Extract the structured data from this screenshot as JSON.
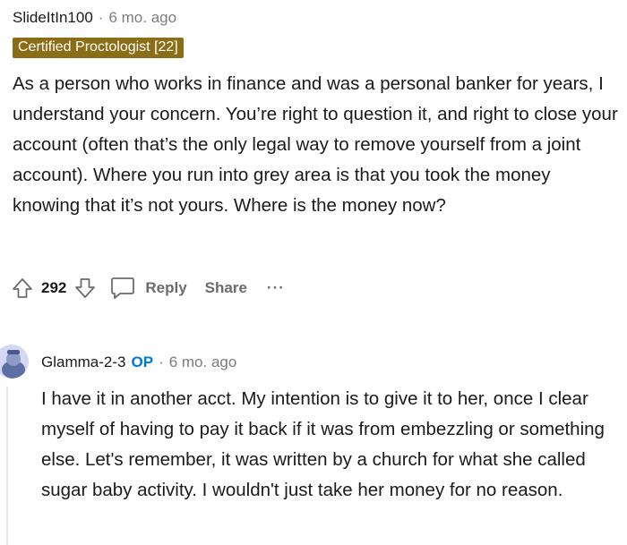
{
  "comment": {
    "username": "SlideItIn100",
    "separator": "·",
    "time": "6 mo. ago",
    "flair": "Certified Proctologist [22]",
    "body": "As a person who works in finance and was a personal banker for years, I understand your concern. You’re right to question it, and right to close your account (often that’s the only legal way to remove yourself from a joint account). Where you run into grey area is that you took the money knowing that it’s not yours. Where is the money now?",
    "score": "292",
    "reply_label": "Reply",
    "share_label": "Share",
    "more_label": "···"
  },
  "reply": {
    "username": "Glamma-2-3",
    "op_badge": "OP",
    "separator": "·",
    "time": "6 mo. ago",
    "body": "I have it in another acct. My intention is to give it to her, once I clear myself of having to pay it back if it was from embezzling or something else. Let's remember, it was written by a church for what she called sugar baby activity. I wouldn't just take her money for no reason."
  },
  "colors": {
    "flair_bg": "#8a6d16",
    "op_blue": "#0079d3",
    "muted": "#7c7c7c"
  },
  "icons": [
    "upvote-icon",
    "downvote-icon",
    "comment-bubble-icon",
    "avatar-icon"
  ]
}
